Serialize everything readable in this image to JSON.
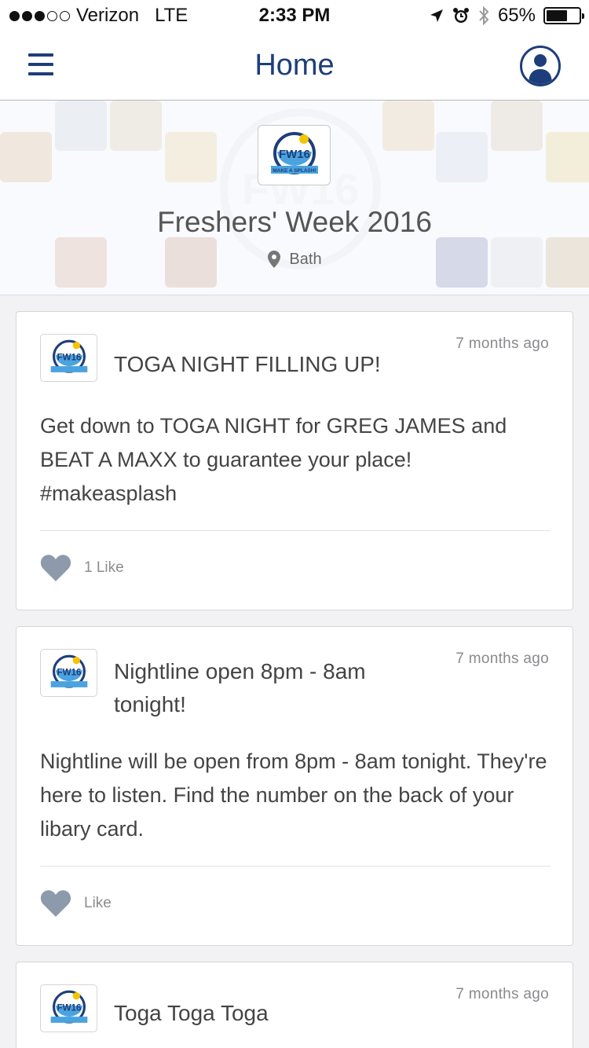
{
  "status_bar": {
    "carrier": "Verizon",
    "network": "LTE",
    "time": "2:33 PM",
    "battery": "65%",
    "battery_level": 0.65
  },
  "nav": {
    "title": "Home"
  },
  "hero": {
    "title": "Freshers' Week 2016",
    "location": "Bath",
    "logo_text": "FW16",
    "logo_subtext": "MAKE A SPLASH!"
  },
  "posts": [
    {
      "title": "TOGA NIGHT FILLING UP!",
      "time": "7 months ago",
      "body": "Get down to TOGA NIGHT for GREG JAMES and BEAT A MAXX to guarantee your place! #makeasplash",
      "likes": "1 Like"
    },
    {
      "title": "Nightline open 8pm - 8am tonight!",
      "time": "7 months ago",
      "body": "Nightline will be open from 8pm - 8am tonight. They're here to listen. Find the number on the back of your libary card.",
      "likes": "Like"
    },
    {
      "title": "Toga Toga Toga",
      "time": "7 months ago"
    }
  ],
  "colors": {
    "brand_navy": "#1d3e7a",
    "like_icon": "#8d9aab"
  }
}
